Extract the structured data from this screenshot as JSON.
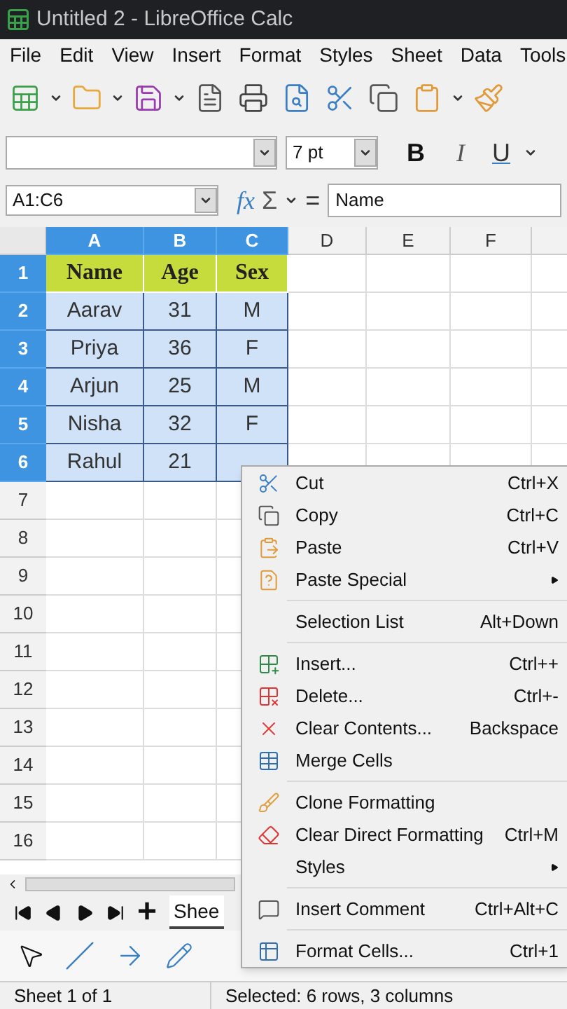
{
  "window": {
    "title": "Untitled 2 - LibreOffice Calc"
  },
  "menu_bar": [
    "File",
    "Edit",
    "View",
    "Insert",
    "Format",
    "Styles",
    "Sheet",
    "Data",
    "Tools"
  ],
  "font_toolbar": {
    "font_size": "7 pt",
    "bold": "B",
    "italic": "I",
    "underline": "U"
  },
  "formula_bar": {
    "name_box": "A1:C6",
    "symbols": [
      "fx",
      "Σ",
      "="
    ],
    "value": "Name"
  },
  "columns": [
    {
      "label": "A",
      "selected": true
    },
    {
      "label": "B",
      "selected": true
    },
    {
      "label": "C",
      "selected": true
    },
    {
      "label": "D",
      "selected": false
    },
    {
      "label": "E",
      "selected": false
    },
    {
      "label": "F",
      "selected": false
    }
  ],
  "rows": [
    {
      "label": "1",
      "selected": true,
      "kind": "header",
      "cells": [
        "Name",
        "Age",
        "Sex"
      ]
    },
    {
      "label": "2",
      "selected": true,
      "kind": "data",
      "cells": [
        "Aarav",
        "31",
        "M"
      ]
    },
    {
      "label": "3",
      "selected": true,
      "kind": "data",
      "cells": [
        "Priya",
        "36",
        "F"
      ]
    },
    {
      "label": "4",
      "selected": true,
      "kind": "data",
      "cells": [
        "Arjun",
        "25",
        "M"
      ]
    },
    {
      "label": "5",
      "selected": true,
      "kind": "data",
      "cells": [
        "Nisha",
        "32",
        "F"
      ]
    },
    {
      "label": "6",
      "selected": true,
      "kind": "data",
      "cells": [
        "Rahul",
        "21"
      ]
    },
    {
      "label": "7",
      "selected": false,
      "kind": "data",
      "cells": []
    },
    {
      "label": "8",
      "selected": false,
      "kind": "data",
      "cells": []
    },
    {
      "label": "9",
      "selected": false,
      "kind": "data",
      "cells": []
    },
    {
      "label": "10",
      "selected": false,
      "kind": "data",
      "cells": []
    },
    {
      "label": "11",
      "selected": false,
      "kind": "data",
      "cells": []
    },
    {
      "label": "12",
      "selected": false,
      "kind": "data",
      "cells": []
    },
    {
      "label": "13",
      "selected": false,
      "kind": "data",
      "cells": []
    },
    {
      "label": "14",
      "selected": false,
      "kind": "data",
      "cells": []
    },
    {
      "label": "15",
      "selected": false,
      "kind": "data",
      "cells": []
    },
    {
      "label": "16",
      "selected": false,
      "kind": "data",
      "cells": []
    }
  ],
  "context_menu": [
    {
      "kind": "item",
      "label": "Cut",
      "shortcut": "Ctrl+X"
    },
    {
      "kind": "item",
      "label": "Copy",
      "shortcut": "Ctrl+C"
    },
    {
      "kind": "item",
      "label": "Paste",
      "shortcut": "Ctrl+V"
    },
    {
      "kind": "submenu",
      "label": "Paste Special"
    },
    {
      "kind": "separator"
    },
    {
      "kind": "item",
      "label": "Selection List",
      "shortcut": "Alt+Down"
    },
    {
      "kind": "separator"
    },
    {
      "kind": "item",
      "label": "Insert...",
      "shortcut": "Ctrl++"
    },
    {
      "kind": "item",
      "label": "Delete...",
      "shortcut": "Ctrl+-"
    },
    {
      "kind": "item",
      "label": "Clear Contents...",
      "shortcut": "Backspace"
    },
    {
      "kind": "item",
      "label": "Merge Cells"
    },
    {
      "kind": "separator"
    },
    {
      "kind": "item",
      "label": "Clone Formatting"
    },
    {
      "kind": "item",
      "label": "Clear Direct Formatting",
      "shortcut": "Ctrl+M"
    },
    {
      "kind": "submenu",
      "label": "Styles"
    },
    {
      "kind": "separator"
    },
    {
      "kind": "item",
      "label": "Insert Comment",
      "shortcut": "Ctrl+Alt+C"
    },
    {
      "kind": "separator"
    },
    {
      "kind": "item",
      "label": "Format Cells...",
      "shortcut": "Ctrl+1"
    }
  ],
  "sheet_tabs": [
    {
      "label": "Shee",
      "selected": true
    }
  ],
  "add_sheet": "+",
  "status_bar": [
    "Sheet 1 of 1",
    "Selected: 6 rows, 3 columns"
  ]
}
